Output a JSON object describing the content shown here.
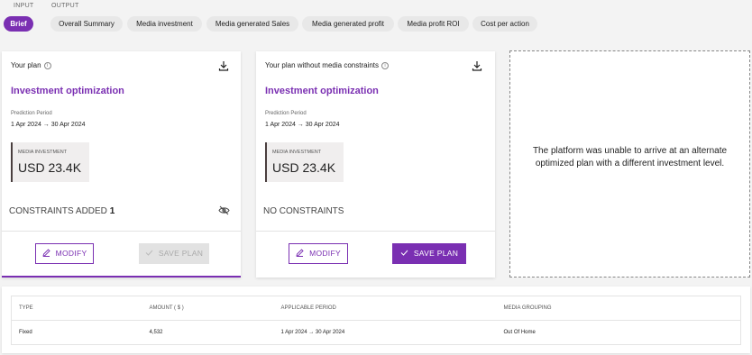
{
  "header": {
    "input_label": "INPUT",
    "output_label": "OUTPUT",
    "tabs": [
      {
        "label": "Brief",
        "active": true
      },
      {
        "label": "Overall Summary",
        "active": false
      },
      {
        "label": "Media investment",
        "active": false
      },
      {
        "label": "Media generated Sales",
        "active": false
      },
      {
        "label": "Media generated profit",
        "active": false
      },
      {
        "label": "Media profit ROI",
        "active": false
      },
      {
        "label": "Cost per action",
        "active": false
      }
    ]
  },
  "plans": [
    {
      "header": "Your plan",
      "title": "Investment optimization",
      "prediction_label": "Prediction Period",
      "prediction_value": "1 Apr 2024 → 30 Apr 2024",
      "investment_label": "MEDIA INVESTMENT",
      "investment_value": "USD 23.4K",
      "constraints_text": "CONSTRAINTS ADDED",
      "constraints_count": "1",
      "modify_label": "MODIFY",
      "save_label": "SAVE PLAN",
      "save_enabled": false
    },
    {
      "header": "Your plan without media constraints",
      "title": "Investment optimization",
      "prediction_label": "Prediction Period",
      "prediction_value": "1 Apr 2024 → 30 Apr 2024",
      "investment_label": "MEDIA INVESTMENT",
      "investment_value": "USD 23.4K",
      "constraints_text": "NO CONSTRAINTS",
      "modify_label": "MODIFY",
      "save_label": "SAVE PLAN",
      "save_enabled": true
    }
  ],
  "alternate_message": "The platform was unable to arrive at an alternate optimized plan with a different investment level.",
  "constraints_table": {
    "headers": [
      "TYPE",
      "AMOUNT ( $ )",
      "APPLICABLE PERIOD",
      "MEDIA GROUPING"
    ],
    "rows": [
      [
        "Fixed",
        "4,532",
        "1 Apr 2024 → 30 Apr 2024",
        "Out Of Home"
      ]
    ]
  },
  "colors": {
    "accent": "#7a2fb2",
    "disabled": "#e2e2e2"
  },
  "icons": {
    "info": "info-icon",
    "download": "download-icon",
    "hidden": "eye-off-icon",
    "pencil": "pencil-icon",
    "check": "check-icon"
  }
}
